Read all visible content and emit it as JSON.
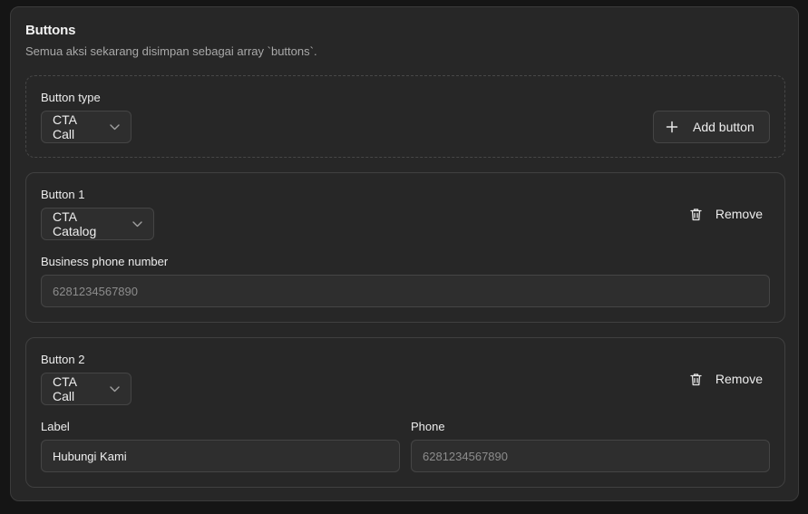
{
  "section": {
    "title": "Buttons",
    "subtitle": "Semua aksi sekarang disimpan sebagai array `buttons`."
  },
  "button_type": {
    "label": "Button type",
    "selected": "CTA Call",
    "add_label": "Add button"
  },
  "buttons": [
    {
      "heading": "Button 1",
      "type": "CTA Catalog",
      "remove_label": "Remove",
      "phone_label": "Business phone number",
      "phone_placeholder": "6281234567890"
    },
    {
      "heading": "Button 2",
      "type": "CTA Call",
      "remove_label": "Remove",
      "label_label": "Label",
      "label_value": "Hubungi Kami",
      "phone_label": "Phone",
      "phone_placeholder": "6281234567890"
    }
  ],
  "icons": {
    "chevron": "chevron-down-icon",
    "plus": "plus-icon",
    "trash": "trash-icon"
  }
}
